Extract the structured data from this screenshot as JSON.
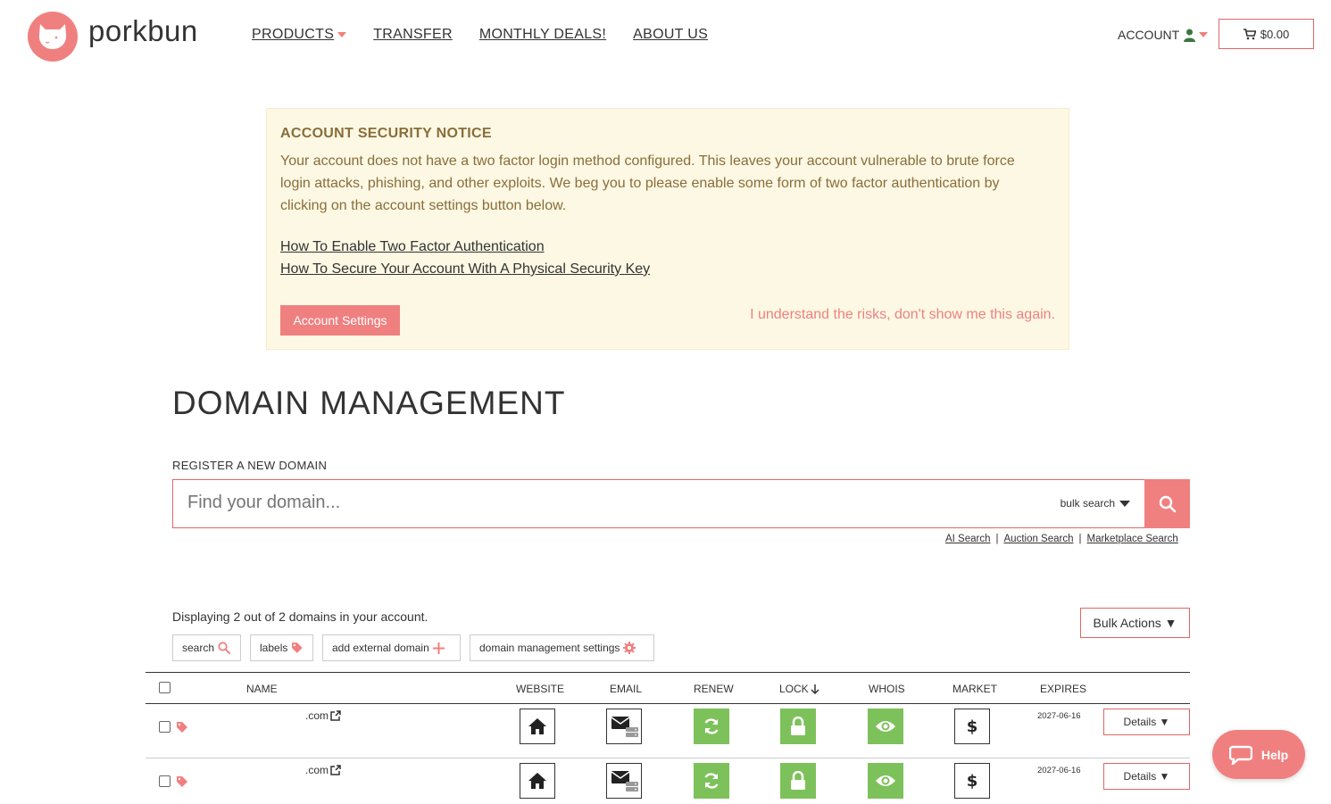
{
  "header": {
    "brand": "porkbun",
    "nav": [
      {
        "label": "PRODUCTS"
      },
      {
        "label": "TRANSFER"
      },
      {
        "label": "MONTHLY DEALS!"
      },
      {
        "label": "ABOUT US"
      }
    ],
    "account_label": "ACCOUNT",
    "cart_total": "$0.00"
  },
  "notice": {
    "title": "ACCOUNT SECURITY NOTICE",
    "body": "Your account does not have a two factor login method configured. This leaves your account vulnerable to brute force login attacks, phishing, and other exploits. We beg you to please enable some form of two factor authentication by clicking on the account settings button below.",
    "link_2fa": "How To Enable Two Factor Authentication",
    "link_key": "How To Secure Your Account With A Physical Security Key",
    "settings_button": "Account Settings",
    "dismiss": "I understand the risks, don't show me this again."
  },
  "main": {
    "title": "DOMAIN MANAGEMENT",
    "register_label": "REGISTER A NEW DOMAIN",
    "search_placeholder": "Find your domain...",
    "bulk_search": "bulk search",
    "sub_links": [
      "AI Search",
      "Auction Search",
      "Marketplace Search"
    ],
    "displaying": "Displaying 2 out of 2 domains in your account.",
    "filters": {
      "search": "search",
      "labels": "labels",
      "add_external": "add external domain",
      "settings": "domain management settings"
    },
    "bulk_actions": "Bulk Actions ▼"
  },
  "table": {
    "headers": {
      "name": "NAME",
      "website": "WEBSITE",
      "email": "EMAIL",
      "renew": "RENEW",
      "lock": "LOCK",
      "whois": "WHOIS",
      "market": "MARKET",
      "expires": "EXPIRES"
    },
    "rows": [
      {
        "domain": ".com",
        "expires": "2027-06-16",
        "details": "Details ▼"
      },
      {
        "domain": ".com",
        "expires": "2027-06-16",
        "details": "Details ▼"
      }
    ]
  },
  "help_label": "Help",
  "colors": {
    "brand": "#f08080",
    "green": "#7dc15a",
    "notice_bg": "#fcf8e3",
    "notice_text": "#8a6d3b"
  }
}
